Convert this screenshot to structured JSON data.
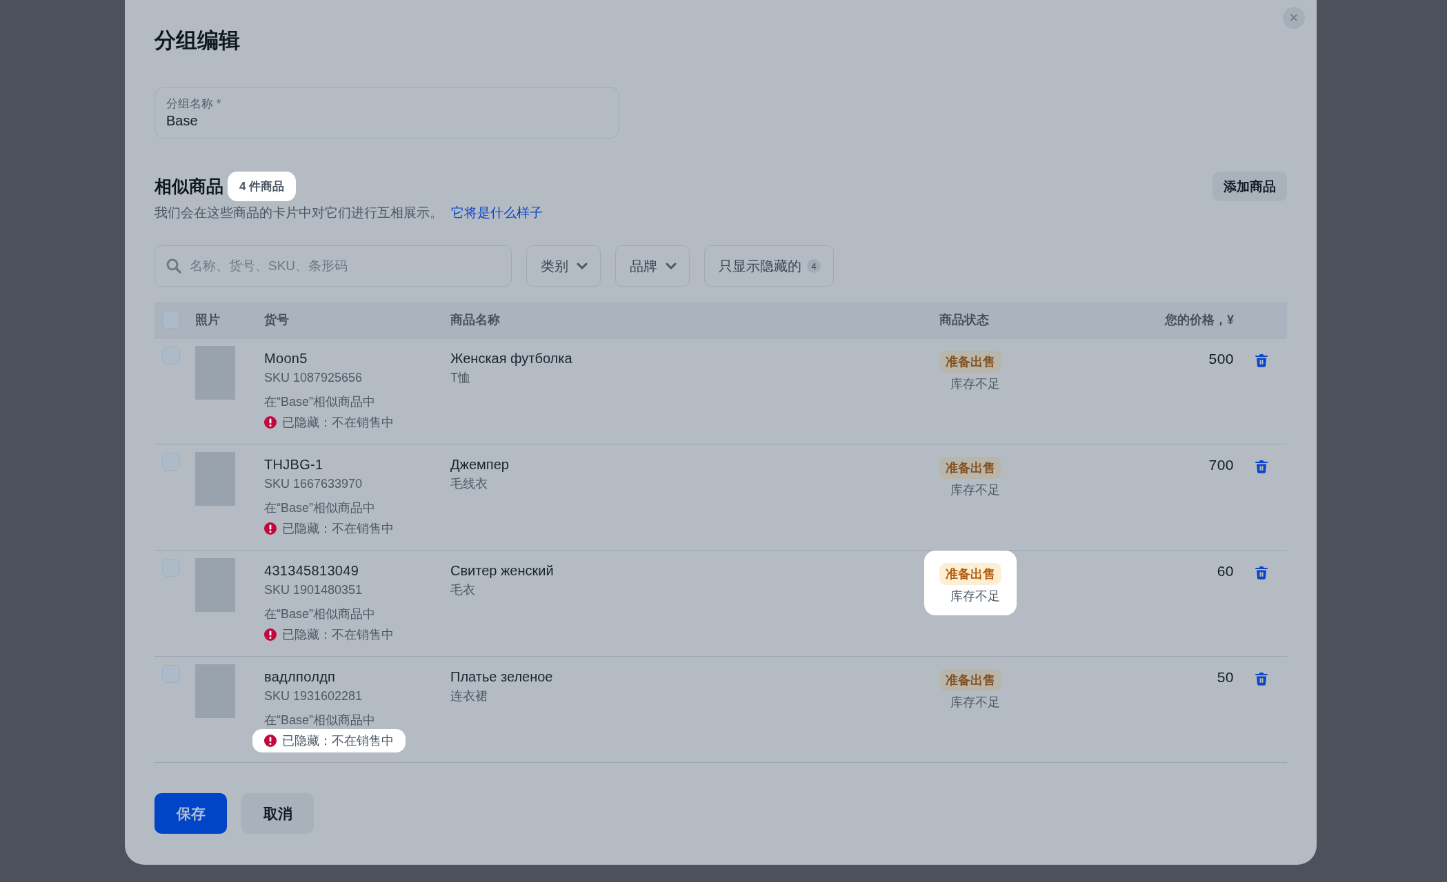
{
  "dialog": {
    "title": "分组编辑",
    "close_label": "×"
  },
  "group_name": {
    "label": "分组名称 *",
    "value": "Base"
  },
  "section": {
    "title": "相似商品",
    "count_badge": {
      "text": "4 件商品",
      "highlighted": true
    },
    "description": "我们会在这些商品的卡片中对它们进行互相展示。",
    "link": "它将是什么样子",
    "add_button": "添加商品"
  },
  "filters": {
    "search": {
      "placeholder": "名称、货号、SKU、条形码"
    },
    "dropdowns": [
      "类别",
      "品牌"
    ],
    "hidden_toggle": {
      "label": "只显示隐藏的",
      "count": "4"
    }
  },
  "table": {
    "select_all": {
      "checked": false
    },
    "columns": [
      "照片",
      "货号",
      "商品名称",
      "商品状态",
      "您的价格，¥"
    ],
    "rows": [
      {
        "checked": false,
        "article": "Moon5",
        "sku": "SKU 1087925656",
        "group_note": "在“Base”相似商品中",
        "hidden_note": {
          "text": "已隐藏：不在销售中",
          "highlighted": false
        },
        "name": "Женская футболка",
        "category": "T恤",
        "status": {
          "label": "准备出售",
          "note": "库存不足",
          "highlighted": false
        },
        "price": "500"
      },
      {
        "checked": false,
        "article": "THJBG-1",
        "sku": "SKU 1667633970",
        "group_note": "在“Base”相似商品中",
        "hidden_note": {
          "text": "已隐藏：不在销售中",
          "highlighted": false
        },
        "name": "Джемпер",
        "category": "毛线衣",
        "status": {
          "label": "准备出售",
          "note": "库存不足",
          "highlighted": false
        },
        "price": "700"
      },
      {
        "checked": false,
        "article": "431345813049",
        "sku": "SKU 1901480351",
        "group_note": "在“Base”相似商品中",
        "hidden_note": {
          "text": "已隐藏：不在销售中",
          "highlighted": false
        },
        "name": "Свитер женский",
        "category": "毛衣",
        "status": {
          "label": "准备出售",
          "note": "库存不足",
          "highlighted": true
        },
        "price": "60"
      },
      {
        "checked": false,
        "article": "вадлполдп",
        "sku": "SKU 1931602281",
        "group_note": "在“Base”相似商品中",
        "hidden_note": {
          "text": "已隐藏：不在销售中",
          "highlighted": true
        },
        "name": "Платье зеленое",
        "category": "连衣裙",
        "status": {
          "label": "准备出售",
          "note": "库存不足",
          "highlighted": false
        },
        "price": "50"
      }
    ]
  },
  "buttons": {
    "save": "保存",
    "cancel": "取消"
  }
}
